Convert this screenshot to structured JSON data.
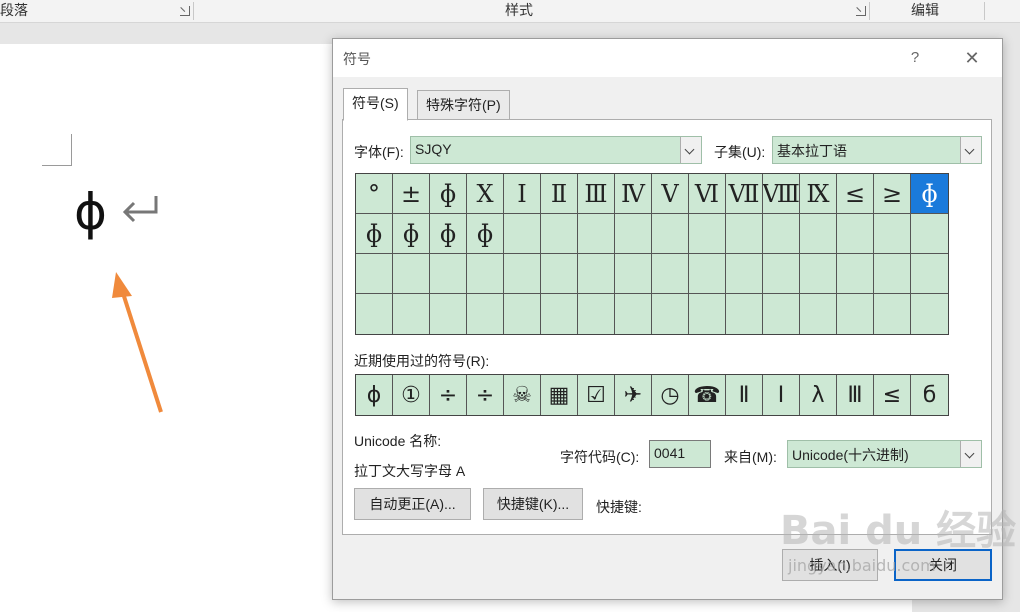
{
  "ribbon": {
    "group_paragraph": "段落",
    "group_styles": "样式",
    "group_editing": "编辑"
  },
  "document": {
    "inserted_char": "ɸ"
  },
  "dialog": {
    "title": "符号",
    "help": "?",
    "close": "✕",
    "tabs": [
      "符号(S)",
      "特殊字符(P)"
    ],
    "font_label": "字体(F):",
    "font_value": "SJQY",
    "subset_label": "子集(U):",
    "subset_value": "基本拉丁语",
    "symbols": [
      "°",
      "±",
      "ɸ",
      "Ⅹ",
      "Ⅰ",
      "Ⅱ",
      "Ⅲ",
      "Ⅳ",
      "Ⅴ",
      "Ⅵ",
      "Ⅶ",
      "Ⅷ",
      "Ⅸ",
      "≤",
      "≥",
      "ɸ",
      "ɸ",
      "ɸ",
      "ɸ",
      "ɸ",
      "",
      "",
      "",
      "",
      "",
      "",
      "",
      "",
      "",
      "",
      "",
      "",
      "",
      "",
      "",
      "",
      "",
      "",
      "",
      "",
      "",
      "",
      "",
      "",
      "",
      "",
      "",
      "",
      "",
      "",
      "",
      "",
      "",
      "",
      "",
      "",
      "",
      "",
      "",
      "",
      "",
      "",
      "",
      ""
    ],
    "selected_index": 15,
    "recent_label": "近期使用过的符号(R):",
    "recent": [
      "ɸ",
      "①",
      "÷",
      "÷",
      "☠",
      "▦",
      "☑",
      "✈",
      "◷",
      "☎",
      "Ⅱ",
      "Ⅰ",
      "λ",
      "Ⅲ",
      "≤",
      "б"
    ],
    "unicode_name_label": "Unicode 名称:",
    "unicode_name_value": "拉丁文大写字母 A",
    "charcode_label": "字符代码(C):",
    "charcode_value": "0041",
    "from_label": "来自(M):",
    "from_value": "Unicode(十六进制)",
    "autocorrect_button": "自动更正(A)...",
    "shortcut_button": "快捷键(K)...",
    "shortcut_label": "快捷键:",
    "insert_button": "插入(I)",
    "close_button": "关闭"
  },
  "watermark": {
    "brand": "Bai du 经验",
    "url": "jingyan.baidu.com"
  },
  "colors": {
    "grid_bg": "#cde8d4",
    "selected_bg": "#1a7adb",
    "arrow": "#f08a3c"
  }
}
